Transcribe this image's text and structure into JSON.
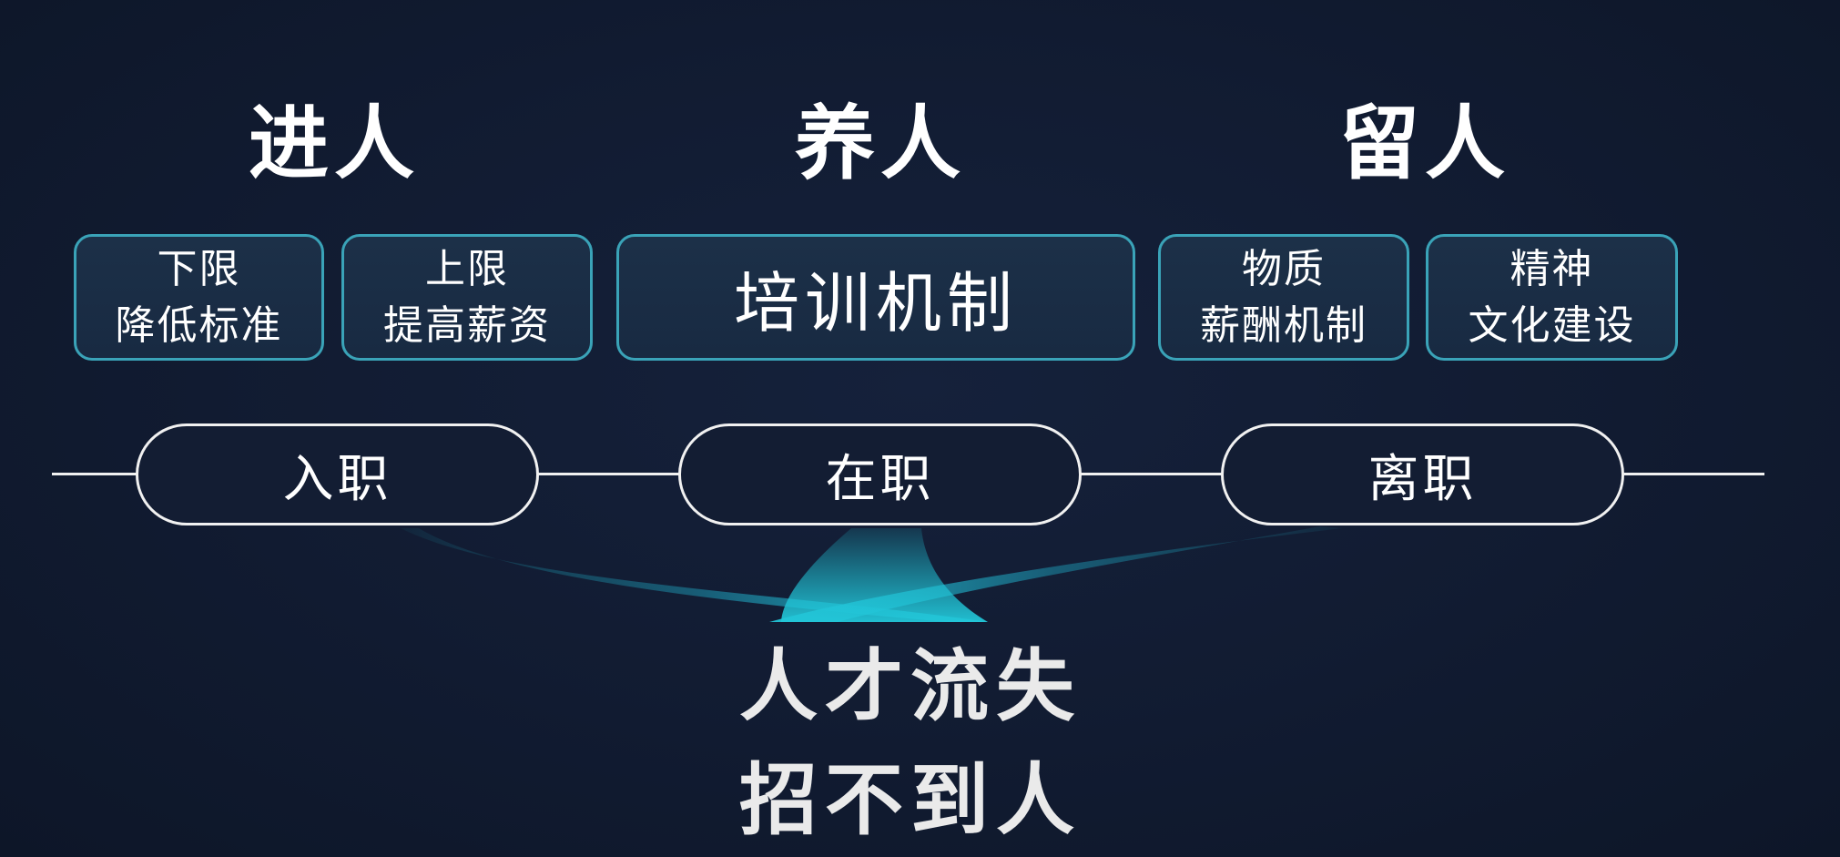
{
  "headings": {
    "recruit": "进人",
    "develop": "养人",
    "retain": "留人"
  },
  "boxes": {
    "lower_limit": {
      "line1": "下限",
      "line2": "降低标准"
    },
    "upper_limit": {
      "line1": "上限",
      "line2": "提高薪资"
    },
    "training": {
      "text": "培训机制"
    },
    "material": {
      "line1": "物质",
      "line2": "薪酬机制"
    },
    "spirit": {
      "line1": "精神",
      "line2": "文化建设"
    }
  },
  "stages": {
    "onboard": "入职",
    "employed": "在职",
    "leave": "离职"
  },
  "outcomes": {
    "talent_loss": "人才流失",
    "cannot_hire": "招不到人"
  },
  "colors": {
    "background": "#111b31",
    "box_border": "#3aa3b8",
    "box_fill": "#1c3048",
    "flow_cyan": "#1fc3d6",
    "line": "#f1f1f1"
  }
}
